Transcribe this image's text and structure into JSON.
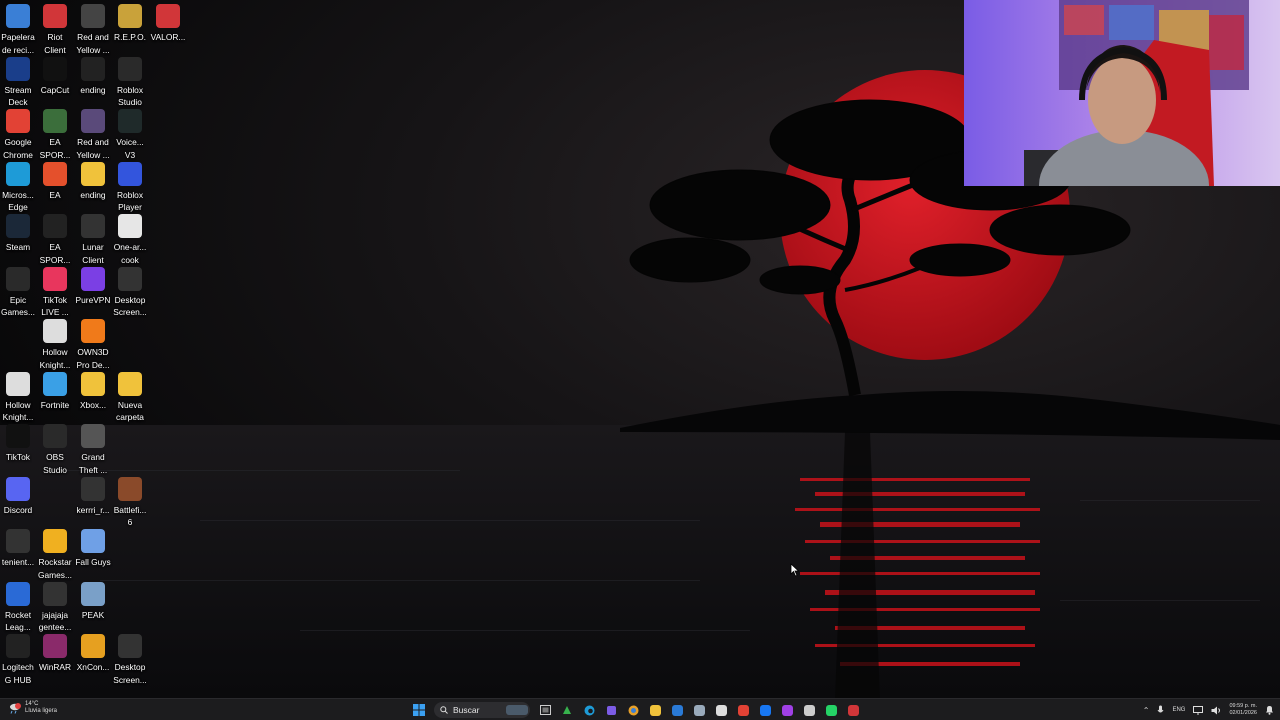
{
  "desktop": {
    "icons": [
      {
        "label": "Papelera\nde reci...",
        "icon": "recycle-bin-icon",
        "color": "#3a7fd6"
      },
      {
        "label": "Riot\nClient",
        "icon": "riot-client-icon",
        "color": "#d13639"
      },
      {
        "label": "Red and\nYellow ...",
        "icon": "red-yellow-thumbnail-icon",
        "color": "#444444"
      },
      {
        "label": "R.E.P.O.",
        "icon": "repo-game-icon",
        "color": "#c9a23a"
      },
      {
        "label": "VALOR...",
        "icon": "valorant-icon",
        "color": "#d13639"
      },
      {
        "label": "Stream\nDeck",
        "icon": "stream-deck-icon",
        "color": "#1a3e8a"
      },
      {
        "label": "CapCut",
        "icon": "capcut-icon",
        "color": "#111111"
      },
      {
        "label": "ending",
        "icon": "video-file-icon",
        "color": "#222222"
      },
      {
        "label": "Roblox\nStudio",
        "icon": "roblox-studio-icon",
        "color": "#2a2a2a"
      },
      {
        "label": "Google\nChrome",
        "icon": "chrome-icon",
        "color": "#e24235"
      },
      {
        "label": "EA\nSPOR...",
        "icon": "ea-sports-icon",
        "color": "#3b6e3b"
      },
      {
        "label": "Red and\nYellow ...",
        "icon": "red-yellow-thumbnail-icon",
        "color": "#5a4a7a"
      },
      {
        "label": "Voice...\nV3",
        "icon": "voicemod-icon",
        "color": "#1f2a2a"
      },
      {
        "label": "Micros...\nEdge",
        "icon": "edge-icon",
        "color": "#1e9bd7"
      },
      {
        "label": "EA",
        "icon": "ea-icon",
        "color": "#e4502c"
      },
      {
        "label": "ending",
        "icon": "folder-icon",
        "color": "#f0c23b"
      },
      {
        "label": "Roblox\nPlayer",
        "icon": "roblox-player-icon",
        "color": "#3355dd"
      },
      {
        "label": "Steam",
        "icon": "steam-icon",
        "color": "#1b2838"
      },
      {
        "label": "EA\nSPOR...",
        "icon": "ea-sports-icon",
        "color": "#222222"
      },
      {
        "label": "Lunar\nClient",
        "icon": "lunar-client-icon",
        "color": "#333333"
      },
      {
        "label": "One-ar...\ncook",
        "icon": "one-armed-cook-icon",
        "color": "#e6e6e6"
      },
      {
        "label": "Epic\nGames...",
        "icon": "epic-games-icon",
        "color": "#2a2a2a"
      },
      {
        "label": "TikTok\nLIVE ...",
        "icon": "tiktok-live-icon",
        "color": "#e8365d"
      },
      {
        "label": "PureVPN",
        "icon": "purevpn-icon",
        "color": "#7b3fe4"
      },
      {
        "label": "Desktop\nScreen...",
        "icon": "screenshot-file-icon",
        "color": "#333333"
      },
      {
        "label": "Hollow\nKnight...",
        "icon": "hollow-knight-icon",
        "color": "#dddddd"
      },
      {
        "label": "OWN3D\nPro De...",
        "icon": "own3d-icon",
        "color": "#f07a1a"
      },
      {
        "label": "Hollow\nKnight...",
        "icon": "hollow-knight-icon",
        "color": "#dddddd"
      },
      {
        "label": "Fortnite",
        "icon": "fortnite-icon",
        "color": "#3aa0e6"
      },
      {
        "label": "Xbox...",
        "icon": "folder-icon",
        "color": "#f0c23b"
      },
      {
        "label": "Nueva\ncarpeta",
        "icon": "folder-icon",
        "color": "#f0c23b"
      },
      {
        "label": "TikTok",
        "icon": "tiktok-icon",
        "color": "#111111"
      },
      {
        "label": "OBS\nStudio",
        "icon": "obs-icon",
        "color": "#2a2a2a"
      },
      {
        "label": "Grand\nTheft ...",
        "icon": "gta-icon",
        "color": "#555555"
      },
      {
        "label": "Discord",
        "icon": "discord-icon",
        "color": "#5865f2"
      },
      {
        "label": "kerrri_r...",
        "icon": "screenshot-file-icon",
        "color": "#333333"
      },
      {
        "label": "Battlefi...\n6",
        "icon": "battlefield-icon",
        "color": "#8a4a2a"
      },
      {
        "label": "tenient...",
        "icon": "screenshot-file-icon",
        "color": "#333333"
      },
      {
        "label": "Rockstar\nGames...",
        "icon": "rockstar-icon",
        "color": "#f0b020"
      },
      {
        "label": "Fall Guys",
        "icon": "fall-guys-icon",
        "color": "#6fa0e6"
      },
      {
        "label": "Rocket\nLeag...",
        "icon": "rocket-league-icon",
        "color": "#2a6ad6"
      },
      {
        "label": "jajajaja\ngentee...",
        "icon": "screenshot-file-icon",
        "color": "#333333"
      },
      {
        "label": "PEAK",
        "icon": "peak-icon",
        "color": "#7aa0c8"
      },
      {
        "label": "Logitech\nG HUB",
        "icon": "logitech-icon",
        "color": "#222222"
      },
      {
        "label": "WinRAR",
        "icon": "winrar-icon",
        "color": "#8a2a6a"
      },
      {
        "label": "XnCon...",
        "icon": "xnconvert-icon",
        "color": "#e6a020"
      },
      {
        "label": "Desktop\nScreen...",
        "icon": "screenshot-file-icon",
        "color": "#333333"
      }
    ]
  },
  "taskbar": {
    "weather_temp": "14°C",
    "weather_desc": "Lluvia ligera",
    "search_placeholder": "Buscar",
    "language": "ENG",
    "time": "09:59 p. m.",
    "date": "02/01/2026",
    "apps": [
      {
        "name": "file-explorer-icon",
        "color": "#f0c23b"
      },
      {
        "name": "outlook-icon",
        "color": "#2a7ad6"
      },
      {
        "name": "steam-taskbar-icon",
        "color": "#9ab"
      },
      {
        "name": "capcut-taskbar-icon",
        "color": "#ddd"
      },
      {
        "name": "chrome-taskbar-icon",
        "color": "#e24235"
      },
      {
        "name": "facebook-icon",
        "color": "#1877f2"
      },
      {
        "name": "messenger-icon",
        "color": "#a040e6"
      },
      {
        "name": "obs-taskbar-icon",
        "color": "#ccc"
      },
      {
        "name": "whatsapp-icon",
        "color": "#25d366"
      },
      {
        "name": "riot-taskbar-icon",
        "color": "#d13639"
      }
    ]
  },
  "colors": {
    "moon": "#c8121a",
    "sky_dark": "#0c0c0e",
    "water": "#101014"
  }
}
